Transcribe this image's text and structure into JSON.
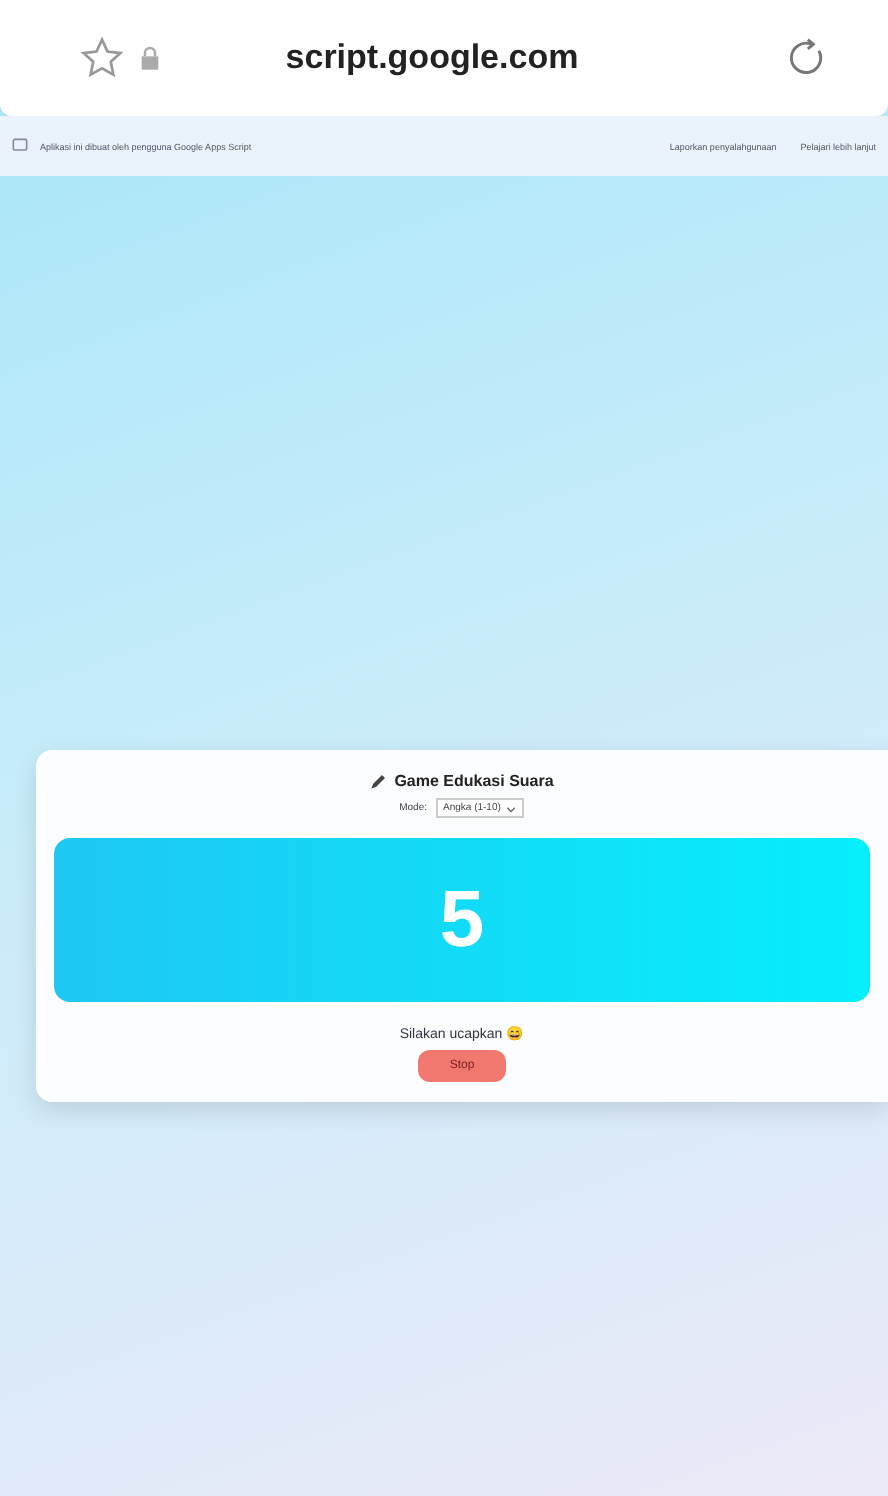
{
  "browser": {
    "url": "script.google.com"
  },
  "banner": {
    "notice": "Aplikasi ini dibuat oleh pengguna Google Apps Script",
    "links": [
      "Laporkan penyalahgunaan",
      "Pelajari lebih lanjut"
    ]
  },
  "game": {
    "title": "Game Edukasi Suara",
    "mode_label": "Mode:",
    "mode_value": "Angka (1-10)",
    "number": "5",
    "prompt": "Silakan ucapkan 😄",
    "button": "Stop"
  }
}
